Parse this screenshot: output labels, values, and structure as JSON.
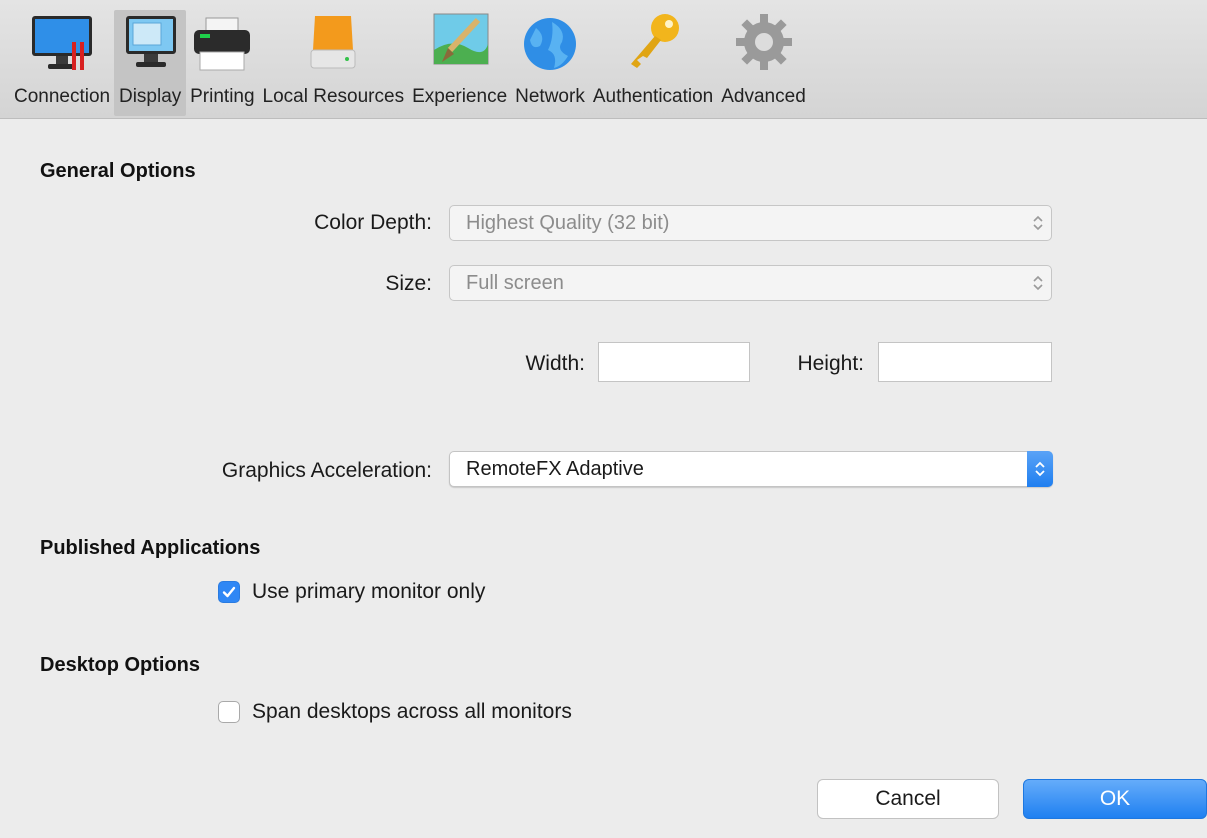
{
  "toolbar": {
    "tabs": [
      {
        "label": "Connection",
        "icon": "monitor-connection-icon"
      },
      {
        "label": "Display",
        "icon": "display-icon",
        "selected": true
      },
      {
        "label": "Printing",
        "icon": "printer-icon"
      },
      {
        "label": "Local Resources",
        "icon": "drive-icon"
      },
      {
        "label": "Experience",
        "icon": "paintbrush-icon"
      },
      {
        "label": "Network",
        "icon": "globe-icon"
      },
      {
        "label": "Authentication",
        "icon": "key-icon"
      },
      {
        "label": "Advanced",
        "icon": "gear-icon"
      }
    ]
  },
  "general": {
    "title": "General Options",
    "color_depth_label": "Color Depth:",
    "color_depth_value": "Highest Quality (32 bit)",
    "size_label": "Size:",
    "size_value": "Full screen",
    "width_label": "Width:",
    "width_value": "",
    "height_label": "Height:",
    "height_value": "",
    "graphics_label": "Graphics Acceleration:",
    "graphics_value": "RemoteFX Adaptive"
  },
  "published": {
    "title": "Published Applications",
    "primary_monitor_label": "Use primary monitor only",
    "primary_monitor_checked": true
  },
  "desktop": {
    "title": "Desktop Options",
    "span_label": "Span desktops across all monitors",
    "span_checked": false
  },
  "buttons": {
    "cancel": "Cancel",
    "ok": "OK"
  },
  "colors": {
    "accent": "#2f87f5",
    "window_bg": "#ececec"
  }
}
